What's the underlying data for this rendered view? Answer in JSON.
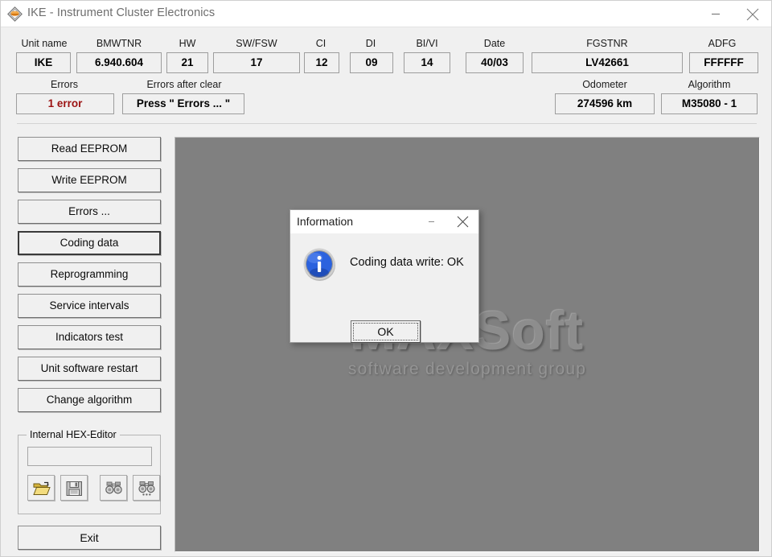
{
  "window": {
    "title": "IKE - Instrument Cluster Electronics",
    "icon": "app-diamond-icon",
    "minimize_label": "–",
    "close_label": "✕"
  },
  "header": {
    "fields": [
      {
        "label": "Unit name",
        "value": "IKE",
        "name": "unit-name"
      },
      {
        "label": "BMWTNR",
        "value": "6.940.604",
        "name": "bmwtnr"
      },
      {
        "label": "HW",
        "value": "21",
        "name": "hw"
      },
      {
        "label": "SW/FSW",
        "value": "17",
        "name": "sw-fsw"
      },
      {
        "label": "CI",
        "value": "12",
        "name": "ci"
      },
      {
        "label": "DI",
        "value": "09",
        "name": "di"
      },
      {
        "label": "BI/VI",
        "value": "14",
        "name": "bi-vi"
      },
      {
        "label": "Date",
        "value": "40/03",
        "name": "date"
      },
      {
        "label": "FGSTNR",
        "value": "LV42661",
        "name": "fgstnr"
      },
      {
        "label": "ADFG",
        "value": "FFFFFF",
        "name": "adfg"
      }
    ],
    "errors": {
      "label": "Errors",
      "value": "1 error",
      "color": "#9b1212"
    },
    "errors_after_clear": {
      "label": "Errors after clear",
      "value": "Press \" Errors ... \""
    },
    "odometer": {
      "label": "Odometer",
      "value": "274596 km"
    },
    "algorithm": {
      "label": "Algorithm",
      "value": "M35080 - 1"
    }
  },
  "sidebar": {
    "buttons": [
      {
        "label": "Read EEPROM",
        "name": "read-eeprom",
        "focused": false
      },
      {
        "label": "Write EEPROM",
        "name": "write-eeprom",
        "focused": false
      },
      {
        "label": "Errors ...",
        "name": "errors",
        "focused": false
      },
      {
        "label": "Coding data",
        "name": "coding-data",
        "focused": true
      },
      {
        "label": "Reprogramming",
        "name": "reprogramming",
        "focused": false
      },
      {
        "label": "Service intervals",
        "name": "service-intervals",
        "focused": false
      },
      {
        "label": "Indicators test",
        "name": "indicators-test",
        "focused": false
      },
      {
        "label": "Unit software restart",
        "name": "unit-software-restart",
        "focused": false
      },
      {
        "label": "Change algorithm",
        "name": "change-algorithm",
        "focused": false
      }
    ],
    "hex_editor": {
      "title": "Internal HEX-Editor",
      "input_value": "",
      "input_placeholder": "",
      "tools": [
        {
          "name": "open-file-icon",
          "enabled": true
        },
        {
          "name": "save-file-icon",
          "enabled": false
        },
        {
          "name": "find-icon",
          "enabled": false
        },
        {
          "name": "find-next-icon",
          "enabled": false
        }
      ]
    },
    "exit_label": "Exit"
  },
  "main": {
    "watermark_main": "MAXSoft",
    "watermark_sub": "software development group",
    "background_color": "#808080"
  },
  "dialog": {
    "title": "Information",
    "message": "Coding data write: OK",
    "ok_label": "OK",
    "icon": "info-icon",
    "minimize_label": "–",
    "close_label": "✕"
  }
}
